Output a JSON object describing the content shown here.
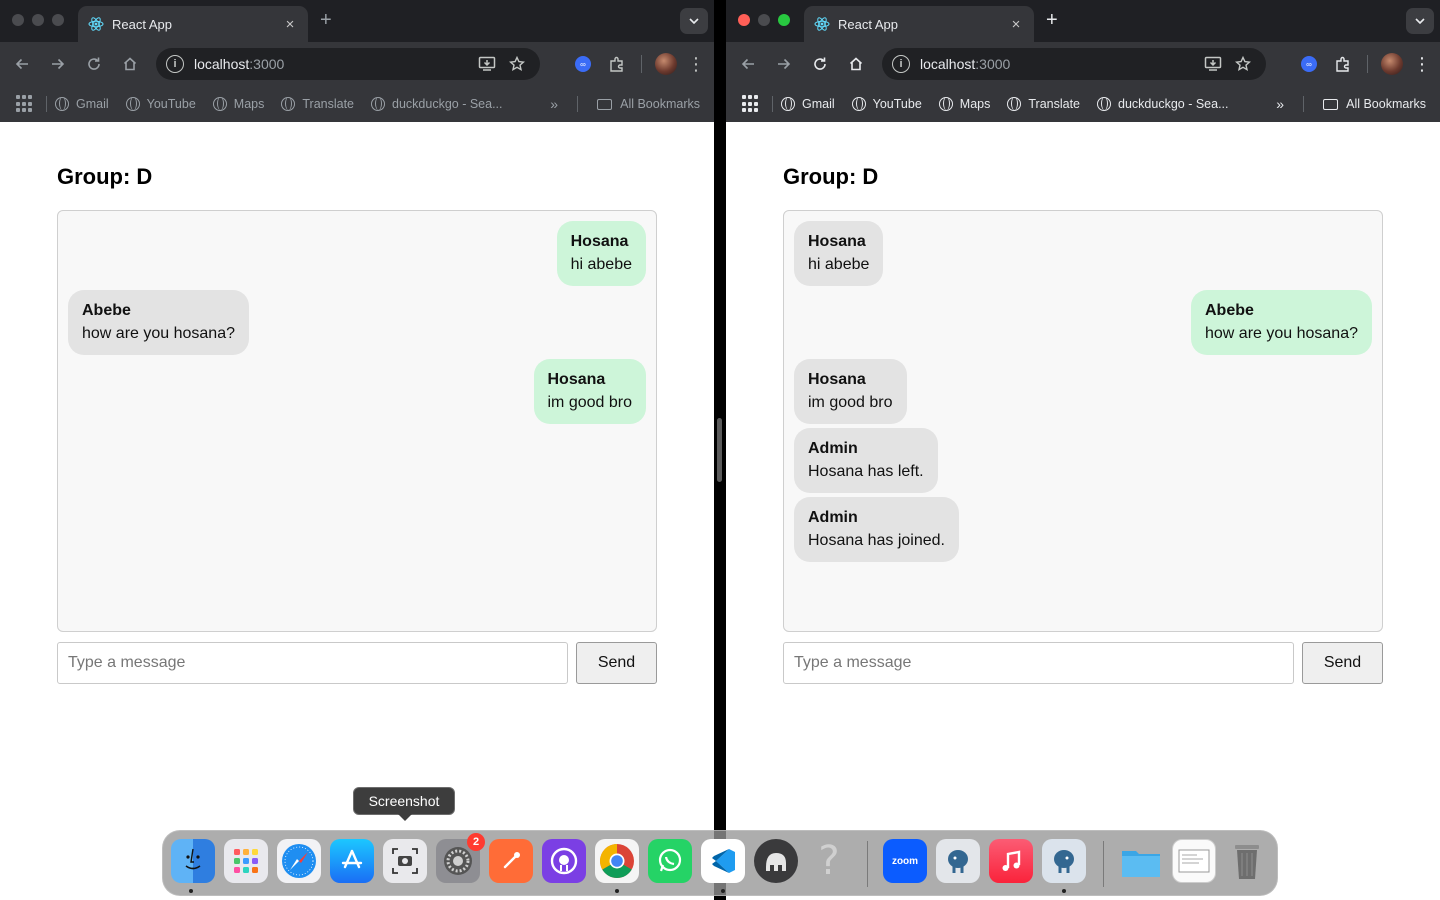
{
  "browser": {
    "tab_title": "React App",
    "tab_close": "×",
    "new_tab": "+",
    "url_host": "localhost",
    "url_port": ":3000",
    "bookmarks": [
      "Gmail",
      "YouTube",
      "Maps",
      "Translate",
      "duckduckgo - Sea..."
    ],
    "bookmarks_more": "»",
    "all_bookmarks": "All Bookmarks"
  },
  "left_window": {
    "group_title": "Group: D",
    "messages": [
      {
        "sender": "Hosana",
        "text": "hi abebe",
        "side": "mine"
      },
      {
        "sender": "Abebe",
        "text": "how are you hosana?",
        "side": "other"
      },
      {
        "sender": "Hosana",
        "text": "im good bro",
        "side": "mine"
      }
    ],
    "input_placeholder": "Type a message",
    "send_label": "Send"
  },
  "right_window": {
    "group_title": "Group: D",
    "messages": [
      {
        "sender": "Hosana",
        "text": "hi abebe",
        "side": "other"
      },
      {
        "sender": "Abebe",
        "text": "how are you hosana?",
        "side": "mine"
      },
      {
        "sender": "Hosana",
        "text": "im good bro",
        "side": "other"
      },
      {
        "sender": "Admin",
        "text": "Hosana has left.",
        "side": "other"
      },
      {
        "sender": "Admin",
        "text": "Hosana has joined.",
        "side": "other"
      }
    ],
    "input_placeholder": "Type a message",
    "send_label": "Send"
  },
  "dock": {
    "tooltip": "Screenshot",
    "settings_badge": "2",
    "zoom_label": "zoom",
    "items": [
      "finder-icon",
      "launchpad-icon",
      "safari-icon",
      "app-store-icon",
      "screenshot-icon",
      "system-settings-icon",
      "postman-icon",
      "github-desktop-icon",
      "chrome-icon",
      "whatsapp-icon",
      "vscode-icon",
      "tableplus-icon",
      "help-icon",
      "zoom-icon",
      "pgadmin-icon",
      "music-icon",
      "postgres-icon",
      "folder-icon",
      "preview-icon",
      "trash-icon"
    ]
  },
  "colors": {
    "mine_bubble": "#cdf5d9",
    "other_bubble": "#e3e3e3",
    "chrome_dark": "#35363a",
    "tab_strip": "#1f2024"
  }
}
